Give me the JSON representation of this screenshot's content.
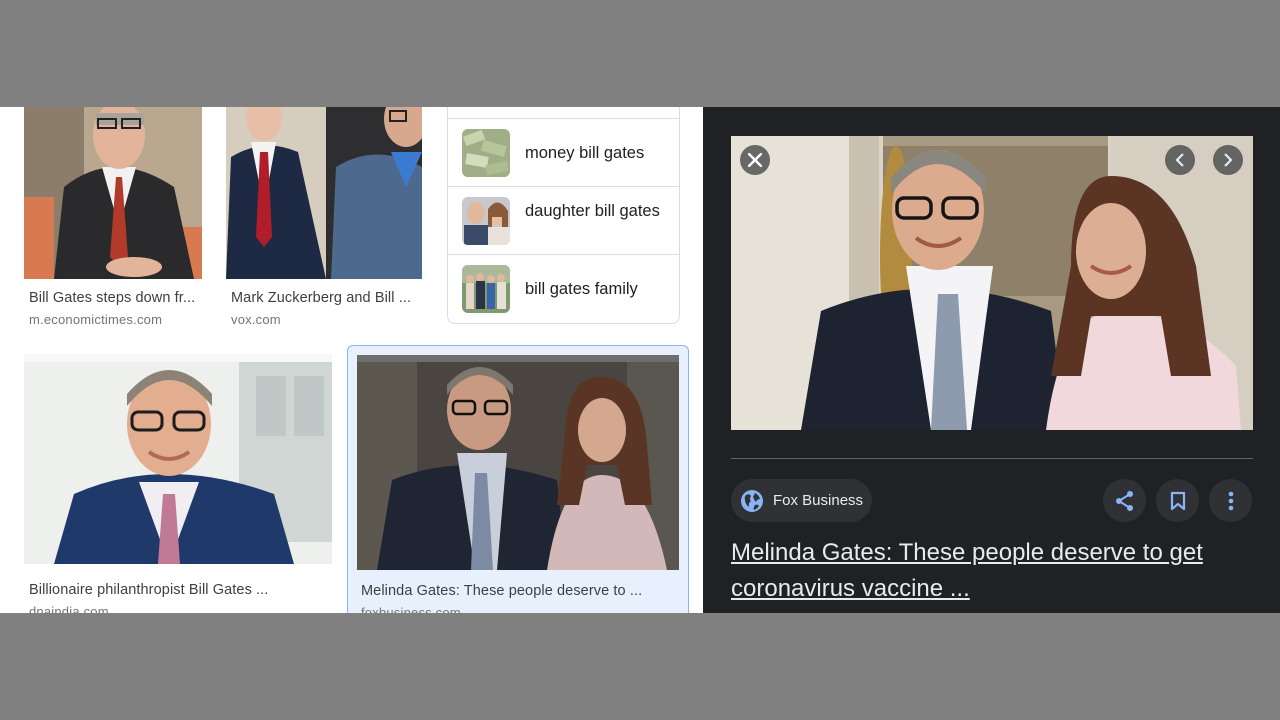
{
  "results": [
    {
      "caption": "Bill Gates steps down fr...",
      "domain": "m.economictimes.com"
    },
    {
      "caption": "Mark Zuckerberg and Bill ...",
      "domain": "vox.com"
    },
    {
      "caption": "Billionaire philanthropist Bill Gates ...",
      "domain": "dnaindia.com"
    },
    {
      "caption": "Melinda Gates: These people deserve to ...",
      "domain": "foxbusiness.com"
    }
  ],
  "related_searches": [
    {
      "label": "money bill gates",
      "icon": "money-thumbnail"
    },
    {
      "label": "daughter bill gates",
      "icon": "daughter-thumbnail"
    },
    {
      "label": "bill gates family",
      "icon": "family-thumbnail"
    }
  ],
  "preview": {
    "source": "Fox Business",
    "title": "Melinda Gates: These people deserve to get coronavirus vaccine ...",
    "icons": [
      "close-icon",
      "chevron-left-icon",
      "chevron-right-icon",
      "globe-icon",
      "share-icon",
      "bookmark-icon",
      "more-vert-icon"
    ]
  },
  "colors": {
    "panel_bg": "#202124",
    "chip_bg": "#303134",
    "accent_blue": "#8ab4f8",
    "selection_bg": "#e8f0fe"
  }
}
